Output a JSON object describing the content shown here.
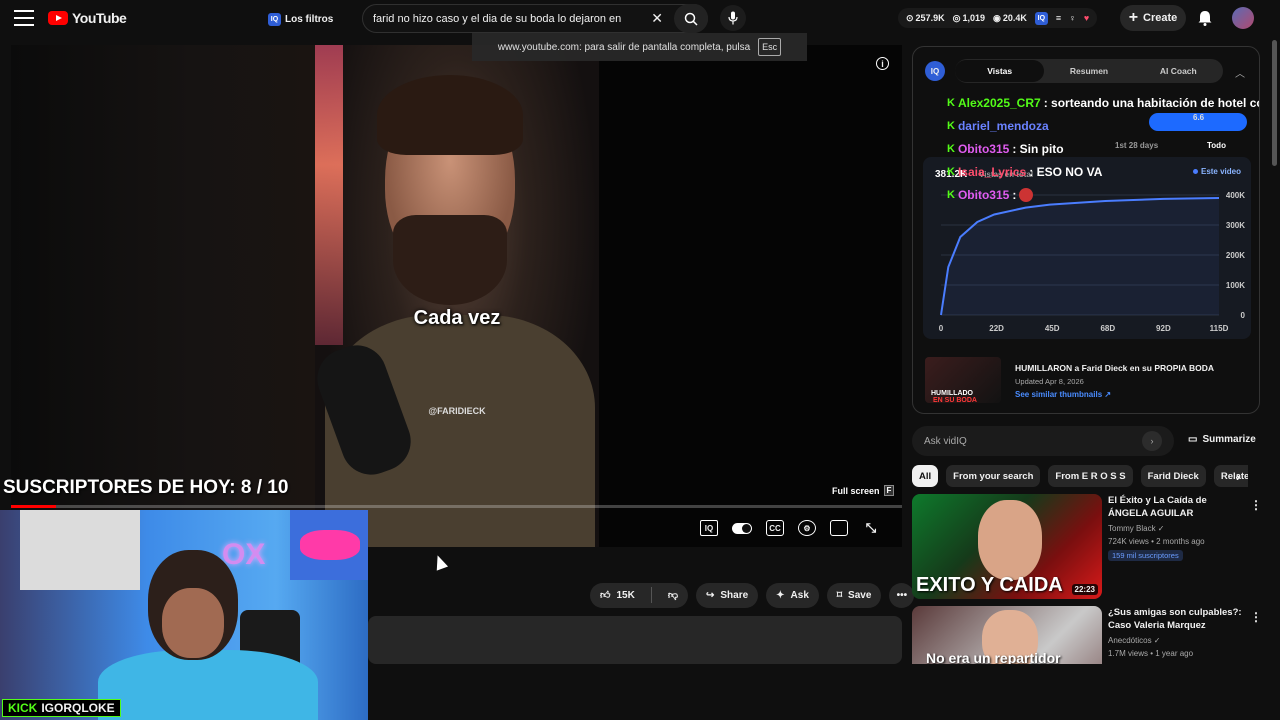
{
  "header": {
    "logo_text": "YouTube",
    "filters_label": "Los filtros",
    "filters_badge": "IQ",
    "search_query": "farid no hizo caso y el dia de su boda lo dejaron en",
    "stats": {
      "subs": "257.9K",
      "videos": "1,019",
      "views": "20.4K"
    },
    "create_label": "Create"
  },
  "toast": {
    "text": "www.youtube.com: para salir de pantalla completa, pulsa",
    "key": "Esc"
  },
  "player": {
    "caption": "Cada vez",
    "handle": "@FARIDIECK",
    "fullscreen_tip": "Full screen",
    "fullscreen_key": "F",
    "progress": 0.05
  },
  "overlay": {
    "subs_text": "SUSCRIPTORES DE HOY: 8 / 10",
    "kick_label": "KICK",
    "kick_user": "IGORQLOKE"
  },
  "actions": {
    "likes": "15K",
    "share": "Share",
    "ask": "Ask",
    "save": "Save"
  },
  "vidiq": {
    "badge": "IQ",
    "tabs": [
      "Vistas",
      "Resumen",
      "AI Coach"
    ],
    "active_tab": 0,
    "chat": [
      {
        "user": "Alex2025_CR7",
        "text": ": sorteando una habitación de hotel con u",
        "cls": "u1"
      },
      {
        "user": "dariel_mendoza",
        "text": "",
        "cls": "u2"
      },
      {
        "user": "Obito315",
        "text": ": Sin pito",
        "cls": "u3"
      },
      {
        "user": "Isaia_Lyrics",
        "text": ": ESO NO VA",
        "cls": "u4"
      },
      {
        "user": "Obito315",
        "text": ":",
        "cls": "u3"
      }
    ],
    "stat_right": "6.6",
    "range": "1st 28 days",
    "range_all": "Todo",
    "views_value": "381.2K",
    "views_label": "Vistas en total",
    "legend": "Este video",
    "chart_yticks": [
      "400K",
      "300K",
      "200K",
      "100K",
      "0"
    ],
    "chart_xticks": [
      "0",
      "22D",
      "45D",
      "68D",
      "92D",
      "115D"
    ],
    "rec_title": "HUMILLARON a Farid Dieck en su PROPIA BODA",
    "rec_date": "Updated Apr 8, 2026",
    "rec_link": "See similar thumbnails ↗",
    "thumb_line1": "HUMILLADO",
    "thumb_line2": "EN SU BODA"
  },
  "chart_data": {
    "type": "line",
    "title": "",
    "xlabel": "",
    "ylabel": "",
    "x": [
      0,
      3,
      8,
      15,
      22,
      35,
      45,
      68,
      92,
      115
    ],
    "series": [
      {
        "values": [
          0,
          160000,
          260000,
          310000,
          335000,
          358000,
          368000,
          380000,
          387000,
          390000
        ]
      }
    ],
    "xlim": [
      0,
      115
    ],
    "ylim": [
      0,
      400000
    ]
  },
  "sidebar": {
    "ask_placeholder": "Ask vidIQ",
    "summarize": "Summarize",
    "chips": [
      "All",
      "From your search",
      "From E R O S S",
      "Farid Dieck",
      "Related"
    ],
    "videos": [
      {
        "title": "El Éxito y La Caída de ÁNGELA AGUILAR",
        "channel": "Tommy Black ✓",
        "meta": "724K views • 2 months ago",
        "badge": "159 mil suscriptores",
        "duration": "22:23",
        "thumb_text": "EXITO Y CAIDA"
      },
      {
        "title": "¿Sus amigas son culpables?: Caso Valeria Marquez",
        "channel": "Anecdóticos ✓",
        "meta": "1.7M views • 1 year ago",
        "badge": "",
        "duration": "",
        "thumb_text": "No era un repartidor"
      }
    ]
  }
}
